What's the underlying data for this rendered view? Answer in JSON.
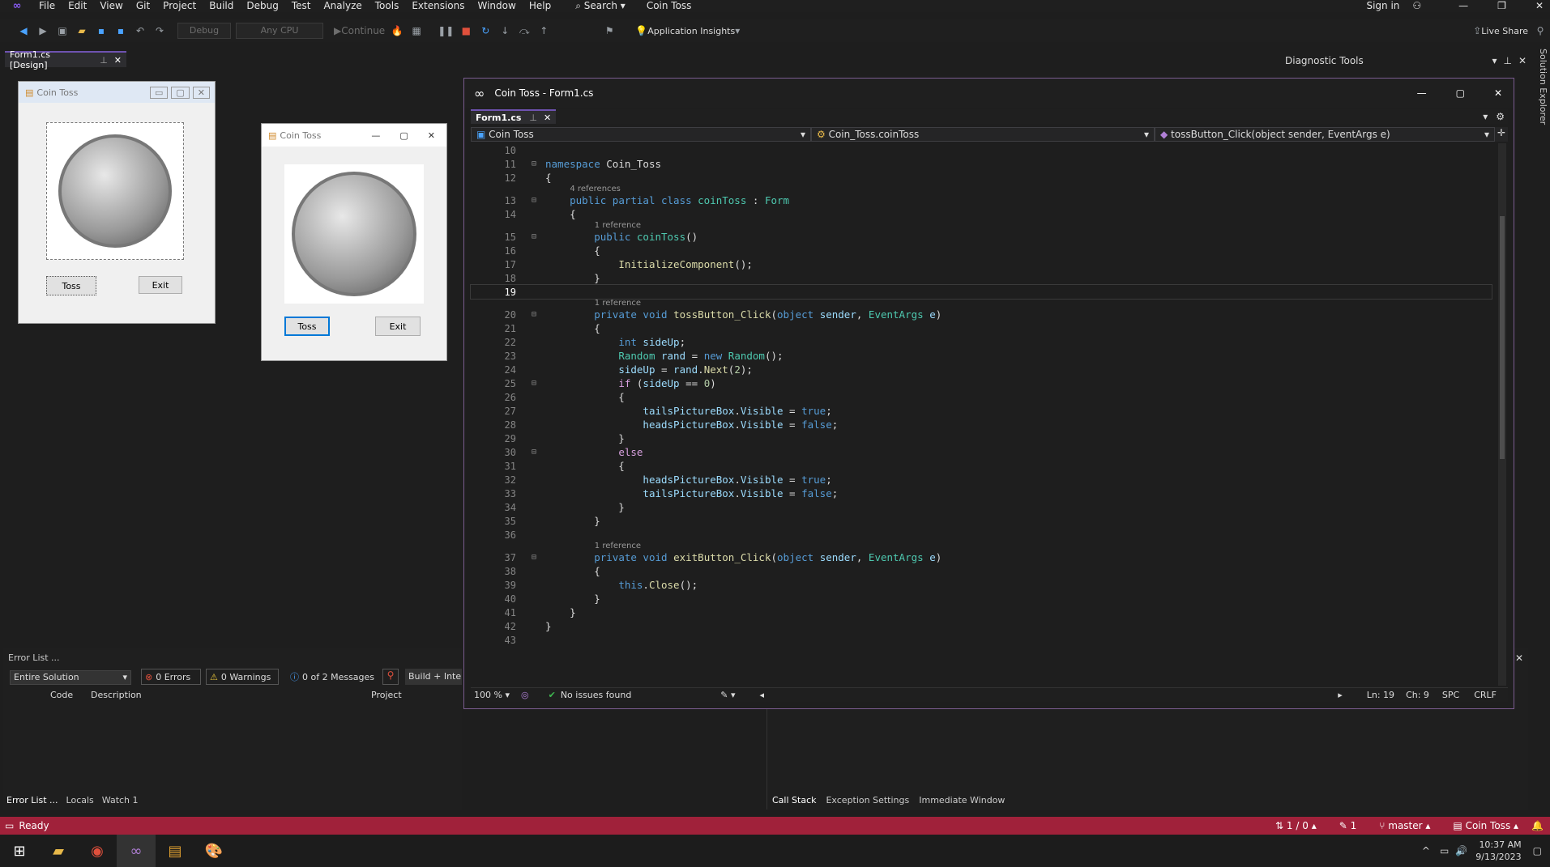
{
  "menu": [
    "File",
    "Edit",
    "View",
    "Git",
    "Project",
    "Build",
    "Debug",
    "Test",
    "Analyze",
    "Tools",
    "Extensions",
    "Window",
    "Help"
  ],
  "search_label": "Search",
  "window_title": "Coin Toss",
  "sign_in": "Sign in",
  "toolbar": {
    "config": "Debug",
    "platform": "Any CPU",
    "continue": "Continue",
    "insights": "Application Insights",
    "live_share": "Live Share"
  },
  "doc_tab": "Form1.cs [Design]",
  "designer_form": {
    "title": "Coin Toss",
    "toss": "Toss",
    "exit": "Exit"
  },
  "running_form": {
    "title": "Coin Toss",
    "toss": "Toss",
    "exit": "Exit"
  },
  "diagnostic": {
    "title": "Diagnostic Tools"
  },
  "solution_explorer": "Solution Explorer",
  "code_window": {
    "title": "Coin Toss - Form1.cs",
    "tab": "Form1.cs",
    "nav_project": "Coin Toss",
    "nav_class": "Coin_Toss.coinToss",
    "nav_member": "tossButton_Click(object sender, EventArgs e)",
    "zoom": "100 %",
    "issues": "No issues found",
    "ln": "Ln: 19",
    "ch": "Ch: 9",
    "spc": "SPC",
    "crlf": "CRLF"
  },
  "code_lines": [
    {
      "n": "10",
      "refs": "",
      "segs": []
    },
    {
      "n": "11",
      "refs": "",
      "segs": [
        [
          "kw",
          "namespace "
        ],
        [
          "pl",
          "Coin_Toss"
        ]
      ]
    },
    {
      "n": "12",
      "refs": "",
      "segs": [
        [
          "pl",
          "{"
        ]
      ]
    },
    {
      "n": "13",
      "refs": "4 references",
      "segs": [
        [
          "pl",
          "    "
        ],
        [
          "kw",
          "public partial class "
        ],
        [
          "ty",
          "coinToss"
        ],
        [
          "pl",
          " : "
        ],
        [
          "ty",
          "Form"
        ]
      ]
    },
    {
      "n": "14",
      "refs": "",
      "segs": [
        [
          "pl",
          "    {"
        ]
      ]
    },
    {
      "n": "15",
      "refs": "1 reference",
      "segs": [
        [
          "pl",
          "        "
        ],
        [
          "kw",
          "public "
        ],
        [
          "ty",
          "coinToss"
        ],
        [
          "pl",
          "()"
        ]
      ]
    },
    {
      "n": "16",
      "refs": "",
      "segs": [
        [
          "pl",
          "        {"
        ]
      ]
    },
    {
      "n": "17",
      "refs": "",
      "segs": [
        [
          "pl",
          "            "
        ],
        [
          "fn",
          "InitializeComponent"
        ],
        [
          "pl",
          "();"
        ]
      ]
    },
    {
      "n": "18",
      "refs": "",
      "segs": [
        [
          "pl",
          "        }"
        ]
      ]
    },
    {
      "n": "19",
      "refs": "",
      "segs": []
    },
    {
      "n": "20",
      "refs": "1 reference",
      "segs": [
        [
          "pl",
          "        "
        ],
        [
          "kw",
          "private void "
        ],
        [
          "fn",
          "tossButton_Click"
        ],
        [
          "pl",
          "("
        ],
        [
          "kw",
          "object "
        ],
        [
          "id",
          "sender"
        ],
        [
          "pl",
          ", "
        ],
        [
          "ty",
          "EventArgs "
        ],
        [
          "id",
          "e"
        ],
        [
          "pl",
          ")"
        ]
      ]
    },
    {
      "n": "21",
      "refs": "",
      "segs": [
        [
          "pl",
          "        {"
        ]
      ]
    },
    {
      "n": "22",
      "refs": "",
      "segs": [
        [
          "pl",
          "            "
        ],
        [
          "kw",
          "int "
        ],
        [
          "id",
          "sideUp"
        ],
        [
          "pl",
          ";"
        ]
      ]
    },
    {
      "n": "23",
      "refs": "",
      "segs": [
        [
          "pl",
          "            "
        ],
        [
          "ty",
          "Random "
        ],
        [
          "id",
          "rand"
        ],
        [
          "pl",
          " = "
        ],
        [
          "kw",
          "new "
        ],
        [
          "ty",
          "Random"
        ],
        [
          "pl",
          "();"
        ]
      ]
    },
    {
      "n": "24",
      "refs": "",
      "segs": [
        [
          "pl",
          "            "
        ],
        [
          "id",
          "sideUp"
        ],
        [
          "pl",
          " = "
        ],
        [
          "id",
          "rand"
        ],
        [
          "pl",
          "."
        ],
        [
          "fn",
          "Next"
        ],
        [
          "pl",
          "("
        ],
        [
          "nm",
          "2"
        ],
        [
          "pl",
          ");"
        ]
      ]
    },
    {
      "n": "25",
      "refs": "",
      "segs": [
        [
          "pl",
          "            "
        ],
        [
          "ctl",
          "if "
        ],
        [
          "pl",
          "("
        ],
        [
          "id",
          "sideUp"
        ],
        [
          "pl",
          " == "
        ],
        [
          "nm",
          "0"
        ],
        [
          "pl",
          ")"
        ]
      ]
    },
    {
      "n": "26",
      "refs": "",
      "segs": [
        [
          "pl",
          "            {"
        ]
      ]
    },
    {
      "n": "27",
      "refs": "",
      "segs": [
        [
          "pl",
          "                "
        ],
        [
          "id",
          "tailsPictureBox"
        ],
        [
          "pl",
          "."
        ],
        [
          "id",
          "Visible"
        ],
        [
          "pl",
          " = "
        ],
        [
          "kw",
          "true"
        ],
        [
          "pl",
          ";"
        ]
      ]
    },
    {
      "n": "28",
      "refs": "",
      "segs": [
        [
          "pl",
          "                "
        ],
        [
          "id",
          "headsPictureBox"
        ],
        [
          "pl",
          "."
        ],
        [
          "id",
          "Visible"
        ],
        [
          "pl",
          " = "
        ],
        [
          "kw",
          "false"
        ],
        [
          "pl",
          ";"
        ]
      ]
    },
    {
      "n": "29",
      "refs": "",
      "segs": [
        [
          "pl",
          "            }"
        ]
      ]
    },
    {
      "n": "30",
      "refs": "",
      "segs": [
        [
          "pl",
          "            "
        ],
        [
          "ctl",
          "else"
        ]
      ]
    },
    {
      "n": "31",
      "refs": "",
      "segs": [
        [
          "pl",
          "            {"
        ]
      ]
    },
    {
      "n": "32",
      "refs": "",
      "segs": [
        [
          "pl",
          "                "
        ],
        [
          "id",
          "headsPictureBox"
        ],
        [
          "pl",
          "."
        ],
        [
          "id",
          "Visible"
        ],
        [
          "pl",
          " = "
        ],
        [
          "kw",
          "true"
        ],
        [
          "pl",
          ";"
        ]
      ]
    },
    {
      "n": "33",
      "refs": "",
      "segs": [
        [
          "pl",
          "                "
        ],
        [
          "id",
          "tailsPictureBox"
        ],
        [
          "pl",
          "."
        ],
        [
          "id",
          "Visible"
        ],
        [
          "pl",
          " = "
        ],
        [
          "kw",
          "false"
        ],
        [
          "pl",
          ";"
        ]
      ]
    },
    {
      "n": "34",
      "refs": "",
      "segs": [
        [
          "pl",
          "            }"
        ]
      ]
    },
    {
      "n": "35",
      "refs": "",
      "segs": [
        [
          "pl",
          "        }"
        ]
      ]
    },
    {
      "n": "36",
      "refs": "",
      "segs": []
    },
    {
      "n": "37",
      "refs": "1 reference",
      "segs": [
        [
          "pl",
          "        "
        ],
        [
          "kw",
          "private void "
        ],
        [
          "fn",
          "exitButton_Click"
        ],
        [
          "pl",
          "("
        ],
        [
          "kw",
          "object "
        ],
        [
          "id",
          "sender"
        ],
        [
          "pl",
          ", "
        ],
        [
          "ty",
          "EventArgs "
        ],
        [
          "id",
          "e"
        ],
        [
          "pl",
          ")"
        ]
      ]
    },
    {
      "n": "38",
      "refs": "",
      "segs": [
        [
          "pl",
          "        {"
        ]
      ]
    },
    {
      "n": "39",
      "refs": "",
      "segs": [
        [
          "pl",
          "            "
        ],
        [
          "kw",
          "this"
        ],
        [
          "pl",
          "."
        ],
        [
          "fn",
          "Close"
        ],
        [
          "pl",
          "();"
        ]
      ]
    },
    {
      "n": "40",
      "refs": "",
      "segs": [
        [
          "pl",
          "        }"
        ]
      ]
    },
    {
      "n": "41",
      "refs": "",
      "segs": [
        [
          "pl",
          "    }"
        ]
      ]
    },
    {
      "n": "42",
      "refs": "",
      "segs": [
        [
          "pl",
          "}"
        ]
      ]
    },
    {
      "n": "43",
      "refs": "",
      "segs": []
    }
  ],
  "error_list": {
    "title": "Error List ...",
    "scope": "Entire Solution",
    "errors": "0 Errors",
    "warnings": "0 Warnings",
    "messages": "0 of 2 Messages",
    "build": "Build + Intel",
    "col_code": "Code",
    "col_desc": "Description",
    "col_project": "Project",
    "bottom_tabs": [
      "Error List ...",
      "Locals",
      "Watch 1"
    ]
  },
  "right_bottom_tabs": [
    "Call Stack",
    "Exception Settings",
    "Immediate Window"
  ],
  "status": {
    "ready": "Ready",
    "updown": "1 / 0",
    "pencil": "1",
    "branch": "master",
    "project": "Coin Toss"
  },
  "clock": {
    "time": "10:37 AM",
    "date": "9/13/2023"
  }
}
